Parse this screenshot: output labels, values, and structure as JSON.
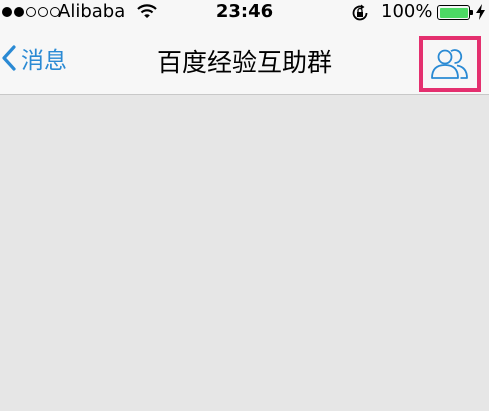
{
  "status_bar": {
    "signal_filled": 2,
    "signal_total": 5,
    "carrier": "Alibaba",
    "time": "23:46",
    "battery_percent": "100%",
    "battery_color": "#4cd964",
    "icons": [
      "signal-dots-icon",
      "wifi-icon",
      "rotation-lock-icon",
      "battery-icon",
      "charging-bolt-icon"
    ]
  },
  "nav": {
    "back_label": "消息",
    "title": "百度经验互助群",
    "accent_color": "#2a8ad4",
    "members_icon": "group-members-icon",
    "highlight_color": "#e4306f"
  }
}
